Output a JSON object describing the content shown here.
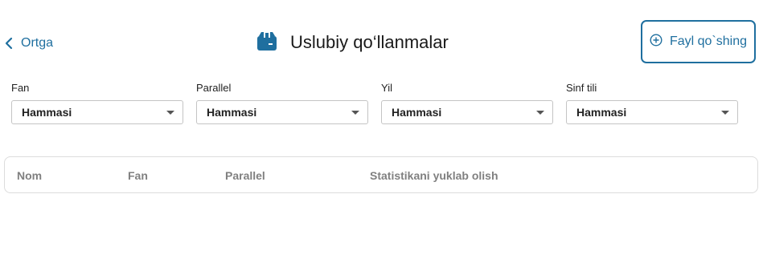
{
  "header": {
    "back_label": "Ortga",
    "title": "Uslubiy qo‘llanmalar",
    "title_icon": "box-icon",
    "add_button_label": "Fayl qo`shing",
    "accent_color": "#1f6f9f"
  },
  "filters": [
    {
      "label": "Fan",
      "value": "Hammasi"
    },
    {
      "label": "Parallel",
      "value": "Hammasi"
    },
    {
      "label": "Yil",
      "value": "Hammasi"
    },
    {
      "label": "Sinf tili",
      "value": "Hammasi"
    }
  ],
  "table": {
    "columns": [
      "Nom",
      "Fan",
      "Parallel",
      "Statistikani yuklab olish"
    ]
  }
}
